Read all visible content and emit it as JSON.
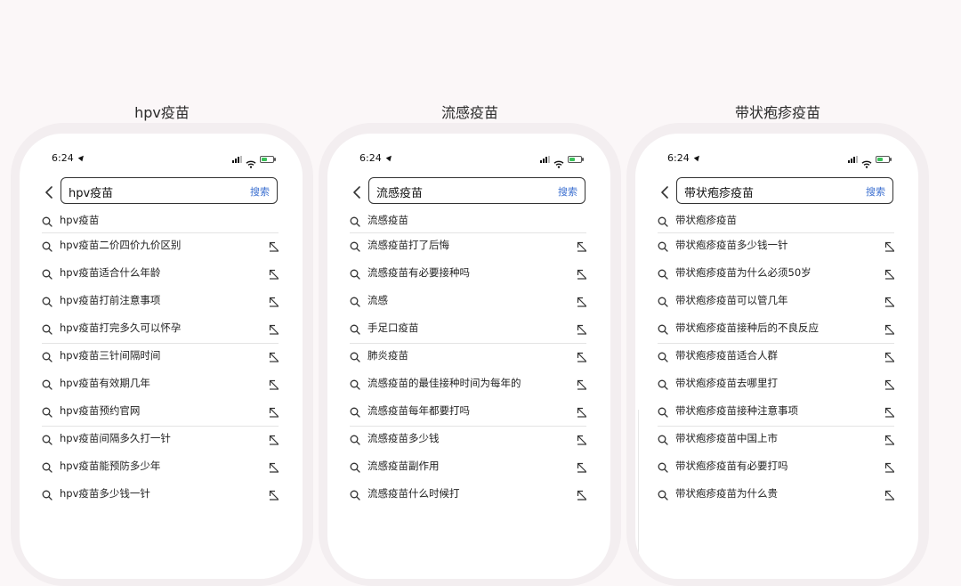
{
  "status": {
    "time": "6:24"
  },
  "search_button_label": "搜索",
  "panels": [
    {
      "title": "hpv疫苗",
      "query": "hpv疫苗",
      "first": "hpv疫苗",
      "suggestions": [
        "hpv疫苗二价四价九价区别",
        "hpv疫苗适合什么年龄",
        "hpv疫苗打前注意事项",
        "hpv疫苗打完多久可以怀孕",
        "hpv疫苗三针间隔时间",
        "hpv疫苗有效期几年",
        "hpv疫苗预约官网",
        "hpv疫苗间隔多久打一针",
        "hpv疫苗能预防多少年",
        "hpv疫苗多少钱一针"
      ]
    },
    {
      "title": "流感疫苗",
      "query": "流感疫苗",
      "first": "流感疫苗",
      "suggestions": [
        "流感疫苗打了后悔",
        "流感疫苗有必要接种吗",
        "流感",
        "手足口疫苗",
        "肺炎疫苗",
        "流感疫苗的最佳接种时间为每年的",
        "流感疫苗每年都要打吗",
        "流感疫苗多少钱",
        "流感疫苗副作用",
        "流感疫苗什么时候打"
      ]
    },
    {
      "title": "带状疱疹疫苗",
      "query": "带状疱疹疫苗",
      "first": "带状疱疹疫苗",
      "suggestions": [
        "带状疱疹疫苗多少钱一针",
        "带状疱疹疫苗为什么必须50岁",
        "带状疱疹疫苗可以管几年",
        "带状疱疹疫苗接种后的不良反应",
        "带状疱疹疫苗适合人群",
        "带状疱疹疫苗去哪里打",
        "带状疱疹疫苗接种注意事项",
        "带状疱疹疫苗中国上市",
        "带状疱疹疫苗有必要打吗",
        "带状疱疹疫苗为什么贵"
      ]
    }
  ],
  "icons": {
    "search": "magnifier-icon",
    "fill": "arrow-up-left-icon",
    "back": "chevron-left-icon",
    "location": "location-arrow-icon",
    "signal": "signal-icon",
    "wifi": "wifi-icon",
    "battery": "battery-charging-icon"
  },
  "colors": {
    "background": "#fbf7f8",
    "search_button": "#3b6fd0",
    "battery_fill": "#3bc15a"
  }
}
